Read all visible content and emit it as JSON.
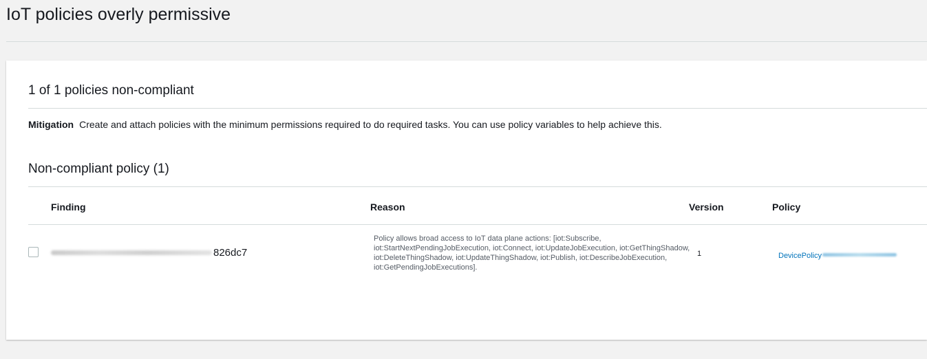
{
  "page": {
    "title": "IoT policies overly permissive"
  },
  "summary": {
    "heading": "1 of 1 policies non-compliant",
    "mitigation_label": "Mitigation",
    "mitigation_text": "Create and attach policies with the minimum permissions required to do required tasks. You can use policy variables to help achieve this."
  },
  "policies_table": {
    "heading": "Non-compliant policy (1)",
    "columns": [
      "Finding",
      "Reason",
      "Version",
      "Policy"
    ],
    "rows": [
      {
        "selected": false,
        "finding_visible_suffix": "826dc7",
        "reason": "Policy allows broad access to IoT data plane actions: [iot:Subscribe, iot:StartNextPendingJobExecution, iot:Connect, iot:UpdateJobExecution, iot:GetThingShadow, iot:DeleteThingShadow, iot:UpdateThingShadow, iot:Publish, iot:DescribeJobExecution, iot:GetPendingJobExecutions].",
        "version": "1",
        "policy_visible_prefix": "DevicePolicy"
      }
    ]
  },
  "colors": {
    "page_background": "#f2f2f2",
    "card_background": "#ffffff",
    "link": "#0073bb",
    "text": "#16191f",
    "muted_text": "#545b64",
    "divider": "#d5dbdb"
  }
}
